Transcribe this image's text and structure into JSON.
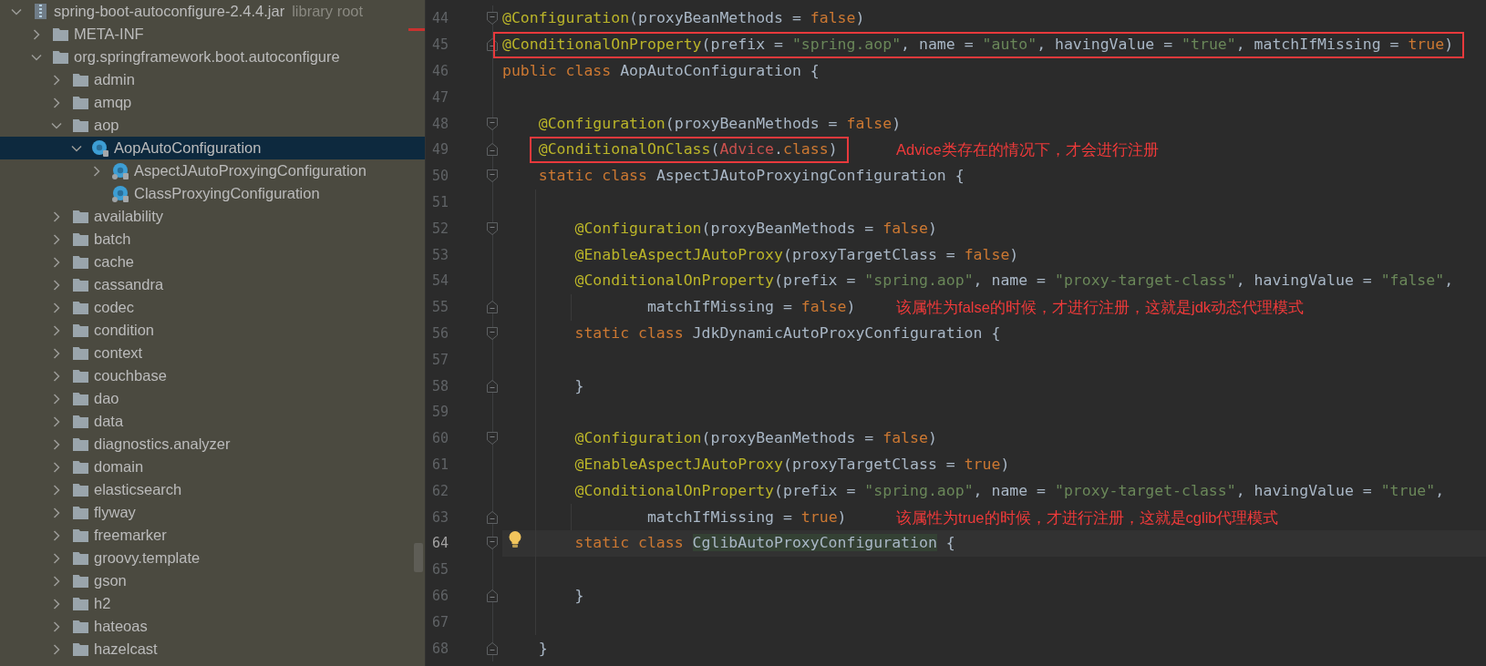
{
  "project_tree": {
    "items": [
      {
        "kind": "jar",
        "label": "spring-boot-autoconfigure-2.4.4.jar",
        "suffix": "library root",
        "expanded": true,
        "selected": false,
        "children": [
          {
            "kind": "folder",
            "label": "META-INF",
            "expanded": false,
            "selected": false
          },
          {
            "kind": "folder",
            "label": "org.springframework.boot.autoconfigure",
            "expanded": true,
            "selected": false,
            "children": [
              {
                "kind": "folder",
                "label": "admin",
                "expanded": false,
                "selected": false
              },
              {
                "kind": "folder",
                "label": "amqp",
                "expanded": false,
                "selected": false
              },
              {
                "kind": "folder",
                "label": "aop",
                "expanded": true,
                "selected": false,
                "children": [
                  {
                    "kind": "class",
                    "label": "AopAutoConfiguration",
                    "expanded": true,
                    "selected": true,
                    "children": [
                      {
                        "kind": "static-class",
                        "label": "AspectJAutoProxyingConfiguration",
                        "expanded": false,
                        "selected": false
                      },
                      {
                        "kind": "static-class",
                        "label": "ClassProxyingConfiguration",
                        "selected": false
                      }
                    ]
                  }
                ]
              },
              {
                "kind": "folder",
                "label": "availability",
                "expanded": false,
                "selected": false
              },
              {
                "kind": "folder",
                "label": "batch",
                "expanded": false,
                "selected": false
              },
              {
                "kind": "folder",
                "label": "cache",
                "expanded": false,
                "selected": false
              },
              {
                "kind": "folder",
                "label": "cassandra",
                "expanded": false,
                "selected": false
              },
              {
                "kind": "folder",
                "label": "codec",
                "expanded": false,
                "selected": false
              },
              {
                "kind": "folder",
                "label": "condition",
                "expanded": false,
                "selected": false
              },
              {
                "kind": "folder",
                "label": "context",
                "expanded": false,
                "selected": false
              },
              {
                "kind": "folder",
                "label": "couchbase",
                "expanded": false,
                "selected": false
              },
              {
                "kind": "folder",
                "label": "dao",
                "expanded": false,
                "selected": false
              },
              {
                "kind": "folder",
                "label": "data",
                "expanded": false,
                "selected": false
              },
              {
                "kind": "folder",
                "label": "diagnostics.analyzer",
                "expanded": false,
                "selected": false
              },
              {
                "kind": "folder",
                "label": "domain",
                "expanded": false,
                "selected": false
              },
              {
                "kind": "folder",
                "label": "elasticsearch",
                "expanded": false,
                "selected": false
              },
              {
                "kind": "folder",
                "label": "flyway",
                "expanded": false,
                "selected": false
              },
              {
                "kind": "folder",
                "label": "freemarker",
                "expanded": false,
                "selected": false
              },
              {
                "kind": "folder",
                "label": "groovy.template",
                "expanded": false,
                "selected": false
              },
              {
                "kind": "folder",
                "label": "gson",
                "expanded": false,
                "selected": false
              },
              {
                "kind": "folder",
                "label": "h2",
                "expanded": false,
                "selected": false
              },
              {
                "kind": "folder",
                "label": "hateoas",
                "expanded": false,
                "selected": false
              },
              {
                "kind": "folder",
                "label": "hazelcast",
                "expanded": false,
                "selected": false
              }
            ]
          }
        ]
      }
    ]
  },
  "editor": {
    "lines": [
      {
        "number": "44",
        "fold": {
          "kind": "start"
        },
        "boxed": false,
        "current": false,
        "bulb": false,
        "tokens": [
          {
            "kind": "annotation",
            "text": "@Configuration"
          },
          {
            "kind": "plain",
            "text": "(proxyBeanMethods = "
          },
          {
            "kind": "keyword",
            "text": "false"
          },
          {
            "kind": "plain",
            "text": ")"
          }
        ]
      },
      {
        "number": "45",
        "fold": {
          "kind": "end"
        },
        "boxed": true,
        "current": false,
        "bulb": false,
        "tokens": [
          {
            "kind": "annotation",
            "text": "@ConditionalOnProperty"
          },
          {
            "kind": "plain",
            "text": "(prefix = "
          },
          {
            "kind": "string",
            "text": "\"spring.aop\""
          },
          {
            "kind": "plain",
            "text": ", name = "
          },
          {
            "kind": "string",
            "text": "\"auto\""
          },
          {
            "kind": "plain",
            "text": ", havingValue = "
          },
          {
            "kind": "string",
            "text": "\"true\""
          },
          {
            "kind": "plain",
            "text": ", matchIfMissing = "
          },
          {
            "kind": "keyword",
            "text": "true"
          },
          {
            "kind": "plain",
            "text": ")"
          }
        ]
      },
      {
        "number": "46",
        "boxed": false,
        "current": false,
        "bulb": false,
        "tokens": [
          {
            "kind": "keyword",
            "text": "public class "
          },
          {
            "kind": "plain",
            "text": "AopAutoConfiguration {"
          }
        ]
      },
      {
        "number": "47",
        "boxed": false,
        "current": false,
        "bulb": false
      },
      {
        "number": "48",
        "fold": {
          "kind": "start"
        },
        "boxed": false,
        "current": false,
        "bulb": false,
        "tokens": [
          {
            "kind": "annotation",
            "text": "    @Configuration"
          },
          {
            "kind": "plain",
            "text": "(proxyBeanMethods = "
          },
          {
            "kind": "keyword",
            "text": "false"
          },
          {
            "kind": "plain",
            "text": ")"
          }
        ]
      },
      {
        "number": "49",
        "fold": {
          "kind": "end"
        },
        "boxed": true,
        "current": false,
        "bulb": false,
        "tokens": [
          {
            "kind": "annotation",
            "text": "    @ConditionalOnClass"
          },
          {
            "kind": "plain",
            "text": "("
          },
          {
            "kind": "unresolved",
            "text": "Advice"
          },
          {
            "kind": "plain",
            "text": "."
          },
          {
            "kind": "keyword",
            "text": "class"
          },
          {
            "kind": "plain",
            "text": ")"
          }
        ],
        "annotation": "Advice类存在的情况下，才会进行注册"
      },
      {
        "number": "50",
        "fold": {
          "kind": "start"
        },
        "boxed": false,
        "current": false,
        "bulb": false,
        "tokens": [
          {
            "kind": "keyword",
            "text": "    static class "
          },
          {
            "kind": "plain",
            "text": "AspectJAutoProxyingConfiguration {"
          }
        ]
      },
      {
        "number": "51",
        "boxed": false,
        "current": false,
        "bulb": false
      },
      {
        "number": "52",
        "fold": {
          "kind": "start"
        },
        "boxed": false,
        "current": false,
        "bulb": false,
        "tokens": [
          {
            "kind": "annotation",
            "text": "        @Configuration"
          },
          {
            "kind": "plain",
            "text": "(proxyBeanMethods = "
          },
          {
            "kind": "keyword",
            "text": "false"
          },
          {
            "kind": "plain",
            "text": ")"
          }
        ]
      },
      {
        "number": "53",
        "boxed": false,
        "current": false,
        "bulb": false,
        "tokens": [
          {
            "kind": "annotation",
            "text": "        @EnableAspectJAutoProxy"
          },
          {
            "kind": "plain",
            "text": "(proxyTargetClass = "
          },
          {
            "kind": "keyword",
            "text": "false"
          },
          {
            "kind": "plain",
            "text": ")"
          }
        ]
      },
      {
        "number": "54",
        "boxed": false,
        "current": false,
        "bulb": false,
        "tokens": [
          {
            "kind": "annotation",
            "text": "        @ConditionalOnProperty"
          },
          {
            "kind": "plain",
            "text": "(prefix = "
          },
          {
            "kind": "string",
            "text": "\"spring.aop\""
          },
          {
            "kind": "plain",
            "text": ", name = "
          },
          {
            "kind": "string",
            "text": "\"proxy-target-class\""
          },
          {
            "kind": "plain",
            "text": ", havingValue = "
          },
          {
            "kind": "string",
            "text": "\"false\""
          },
          {
            "kind": "plain",
            "text": ","
          }
        ]
      },
      {
        "number": "55",
        "fold": {
          "kind": "end"
        },
        "boxed": false,
        "current": false,
        "bulb": false,
        "tokens": [
          {
            "kind": "plain",
            "text": "                matchIfMissing = "
          },
          {
            "kind": "keyword",
            "text": "false"
          },
          {
            "kind": "plain",
            "text": ")"
          }
        ],
        "annotation": "该属性为false的时候，才进行注册，这就是jdk动态代理模式"
      },
      {
        "number": "56",
        "fold": {
          "kind": "start"
        },
        "boxed": false,
        "current": false,
        "bulb": false,
        "tokens": [
          {
            "kind": "keyword",
            "text": "        static class "
          },
          {
            "kind": "plain",
            "text": "JdkDynamicAutoProxyConfiguration {"
          }
        ]
      },
      {
        "number": "57",
        "boxed": false,
        "current": false,
        "bulb": false
      },
      {
        "number": "58",
        "fold": {
          "kind": "end"
        },
        "boxed": false,
        "current": false,
        "bulb": false,
        "tokens": [
          {
            "kind": "plain",
            "text": "        }"
          }
        ]
      },
      {
        "number": "59",
        "boxed": false,
        "current": false,
        "bulb": false
      },
      {
        "number": "60",
        "fold": {
          "kind": "start"
        },
        "boxed": false,
        "current": false,
        "bulb": false,
        "tokens": [
          {
            "kind": "annotation",
            "text": "        @Configuration"
          },
          {
            "kind": "plain",
            "text": "(proxyBeanMethods = "
          },
          {
            "kind": "keyword",
            "text": "false"
          },
          {
            "kind": "plain",
            "text": ")"
          }
        ]
      },
      {
        "number": "61",
        "boxed": false,
        "current": false,
        "bulb": false,
        "tokens": [
          {
            "kind": "annotation",
            "text": "        @EnableAspectJAutoProxy"
          },
          {
            "kind": "plain",
            "text": "(proxyTargetClass = "
          },
          {
            "kind": "keyword",
            "text": "true"
          },
          {
            "kind": "plain",
            "text": ")"
          }
        ]
      },
      {
        "number": "62",
        "boxed": false,
        "current": false,
        "bulb": false,
        "tokens": [
          {
            "kind": "annotation",
            "text": "        @ConditionalOnProperty"
          },
          {
            "kind": "plain",
            "text": "(prefix = "
          },
          {
            "kind": "string",
            "text": "\"spring.aop\""
          },
          {
            "kind": "plain",
            "text": ", name = "
          },
          {
            "kind": "string",
            "text": "\"proxy-target-class\""
          },
          {
            "kind": "plain",
            "text": ", havingValue = "
          },
          {
            "kind": "string",
            "text": "\"true\""
          },
          {
            "kind": "plain",
            "text": ","
          }
        ]
      },
      {
        "number": "63",
        "fold": {
          "kind": "end"
        },
        "boxed": false,
        "current": false,
        "bulb": false,
        "tokens": [
          {
            "kind": "plain",
            "text": "                matchIfMissing = "
          },
          {
            "kind": "keyword",
            "text": "true"
          },
          {
            "kind": "plain",
            "text": ")"
          }
        ],
        "annotation": "该属性为true的时候，才进行注册，这就是cglib代理模式"
      },
      {
        "number": "64",
        "fold": {
          "kind": "start"
        },
        "boxed": false,
        "current": true,
        "bulb": true,
        "tokens": [
          {
            "kind": "keyword",
            "text": "        static class "
          },
          {
            "kind": "highlighted",
            "text": "CglibAutoProxyConfiguration"
          },
          {
            "kind": "plain",
            "text": " {"
          }
        ]
      },
      {
        "number": "65",
        "boxed": false,
        "current": false,
        "bulb": false
      },
      {
        "number": "66",
        "fold": {
          "kind": "end"
        },
        "boxed": false,
        "current": false,
        "bulb": false,
        "tokens": [
          {
            "kind": "plain",
            "text": "        }"
          }
        ]
      },
      {
        "number": "67",
        "boxed": false,
        "current": false,
        "bulb": false
      },
      {
        "number": "68",
        "fold": {
          "kind": "end"
        },
        "boxed": false,
        "current": false,
        "bulb": false,
        "tokens": [
          {
            "kind": "plain",
            "text": "    }"
          }
        ]
      }
    ]
  }
}
